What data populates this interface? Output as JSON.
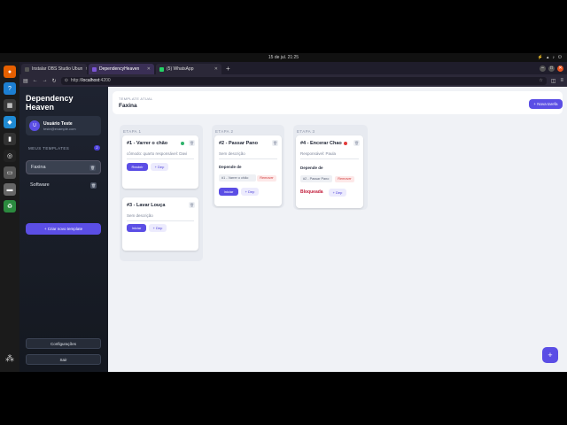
{
  "os": {
    "clock": "15 de jul.  21:25",
    "tray": [
      "⚡",
      "▴",
      "♪",
      "⏻"
    ]
  },
  "dock": {
    "apps": [
      {
        "name": "firefox-icon",
        "glyph": "●",
        "color": "#e66000"
      },
      {
        "name": "help-icon",
        "glyph": "?",
        "color": "#1d7fd1"
      },
      {
        "name": "obs-icon",
        "glyph": "▦",
        "color": "#3b3b3b"
      },
      {
        "name": "vscode-icon",
        "glyph": "◆",
        "color": "#1f8ad2"
      },
      {
        "name": "terminal-icon",
        "glyph": "▮",
        "color": "#333"
      },
      {
        "name": "obs-studio-icon",
        "glyph": "◎",
        "color": "#222"
      },
      {
        "name": "files-icon",
        "glyph": "▭",
        "color": "#555"
      },
      {
        "name": "disk-icon",
        "glyph": "▬",
        "color": "#666"
      },
      {
        "name": "trash-icon",
        "glyph": "♻",
        "color": "#2b8a3e"
      }
    ],
    "apps_grid": "⁂"
  },
  "browser": {
    "tabs": [
      {
        "label": "Instalar OBS Studio Ubun",
        "favicon": "#555"
      },
      {
        "label": "DependencyHeaven",
        "favicon": "#7b55d6"
      },
      {
        "label": "(5) WhatsApp",
        "favicon": "#25d366"
      }
    ],
    "new_tab": "+",
    "url_scheme": "http://",
    "url_host": "localhost",
    "url_port": ":4200"
  },
  "sidebar": {
    "brand": "Dependency Heaven",
    "user": {
      "initial": "U",
      "name": "Usuário Teste",
      "email": "teste@example.com"
    },
    "templates_title": "MEUS TEMPLATES",
    "templates_count": "2",
    "templates": [
      {
        "label": "Faxina",
        "active": true
      },
      {
        "label": "Software",
        "active": false
      }
    ],
    "create_label": "+ Criar novo template",
    "settings_label": "Configurações",
    "logout_label": "Sair"
  },
  "header": {
    "label": "TEMPLATE ATUAL",
    "title": "Faxina",
    "new_task": "+ Nova tarefa"
  },
  "stages": [
    {
      "title": "ETAPA 1",
      "cards": [
        {
          "title": "#1 - Varrer o chão",
          "status_color": "#2fb36b",
          "desc": "cômodo: quarto responsável: Davi",
          "primary": "Reabrir",
          "secondary": "+ Dep"
        },
        {
          "title": "#3 - Lavar Louça",
          "desc": "Sem descrição",
          "primary": "Iniciar",
          "secondary": "+ Dep"
        }
      ]
    },
    {
      "title": "ETAPA 2",
      "cards": [
        {
          "title": "#2 - Passar Pano",
          "desc": "Sem descrição",
          "dep_label": "Depende de",
          "dep": "#1 - Varrer o chão",
          "remove": "Remover",
          "primary": "Iniciar",
          "secondary": "+ Dep"
        }
      ]
    },
    {
      "title": "ETAPA 3",
      "cards": [
        {
          "title": "#4 - Encerar Chao",
          "status_color": "#e23a3a",
          "desc": "Responsável: Paula",
          "dep_label": "Depende de",
          "dep": "#2 - Passar Pano",
          "remove": "Remover",
          "blocked": "Bloqueada",
          "secondary": "+ Dep"
        }
      ]
    }
  ],
  "fab": "+"
}
